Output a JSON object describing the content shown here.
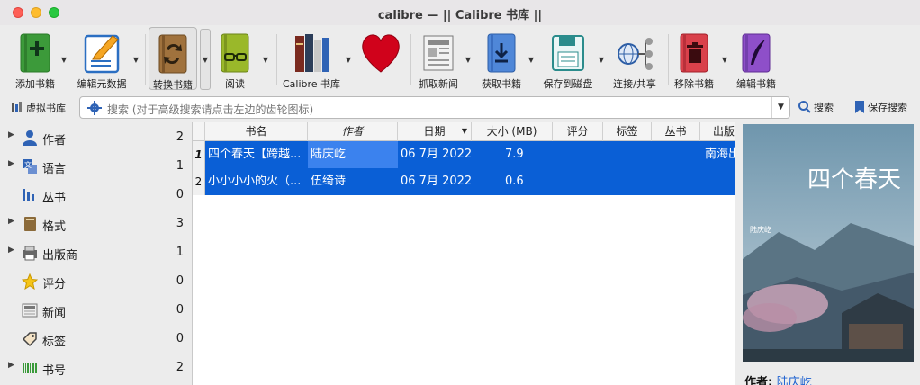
{
  "window": {
    "title": "calibre — || Calibre 书库 ||"
  },
  "toolbar": {
    "add_books": "添加书籍",
    "edit_metadata": "编辑元数据",
    "convert_books": "转换书籍",
    "view": "阅读",
    "calibre_library": "Calibre 书库",
    "fetch_news": "抓取新闻",
    "get_books": "获取书籍",
    "save_to_disk": "保存到磁盘",
    "connect_share": "连接/共享",
    "remove_books": "移除书籍",
    "edit_book": "编辑书籍"
  },
  "search": {
    "virtual_library": "虚拟书库",
    "placeholder": "搜索 (对于高级搜索请点击左边的齿轮图标)",
    "search_button": "搜索",
    "save_search_button": "保存搜索"
  },
  "sidebar": {
    "items": [
      {
        "label": "作者",
        "count": "2",
        "icon": "person-icon"
      },
      {
        "label": "语言",
        "count": "1",
        "icon": "language-icon"
      },
      {
        "label": "丛书",
        "count": "0",
        "icon": "series-icon"
      },
      {
        "label": "格式",
        "count": "3",
        "icon": "format-icon"
      },
      {
        "label": "出版商",
        "count": "1",
        "icon": "publisher-icon"
      },
      {
        "label": "评分",
        "count": "0",
        "icon": "star-icon"
      },
      {
        "label": "新闻",
        "count": "0",
        "icon": "news-icon"
      },
      {
        "label": "标签",
        "count": "0",
        "icon": "tag-icon"
      },
      {
        "label": "书号",
        "count": "2",
        "icon": "barcode-icon"
      }
    ]
  },
  "table": {
    "columns": [
      "书名",
      "作者",
      "日期",
      "大小 (MB)",
      "评分",
      "标签",
      "丛书",
      "出版"
    ],
    "rows": [
      {
        "num": "1",
        "title": "四个春天【跨越...",
        "author": "陆庆屹",
        "date": "06 7月 2022",
        "size": "7.9",
        "publisher": "南海出"
      },
      {
        "num": "2",
        "title": "小小小小的火（...",
        "author": "伍绮诗",
        "date": "06 7月 2022",
        "size": "0.6",
        "publisher": ""
      }
    ]
  },
  "cover": {
    "title_text": "四个春天",
    "author_text": "陆庆屹"
  },
  "details": {
    "author_label": "作者:",
    "author_value": "陆庆屹"
  },
  "colors": {
    "selection": "#0a5fd6",
    "heart": "#d0021b"
  }
}
